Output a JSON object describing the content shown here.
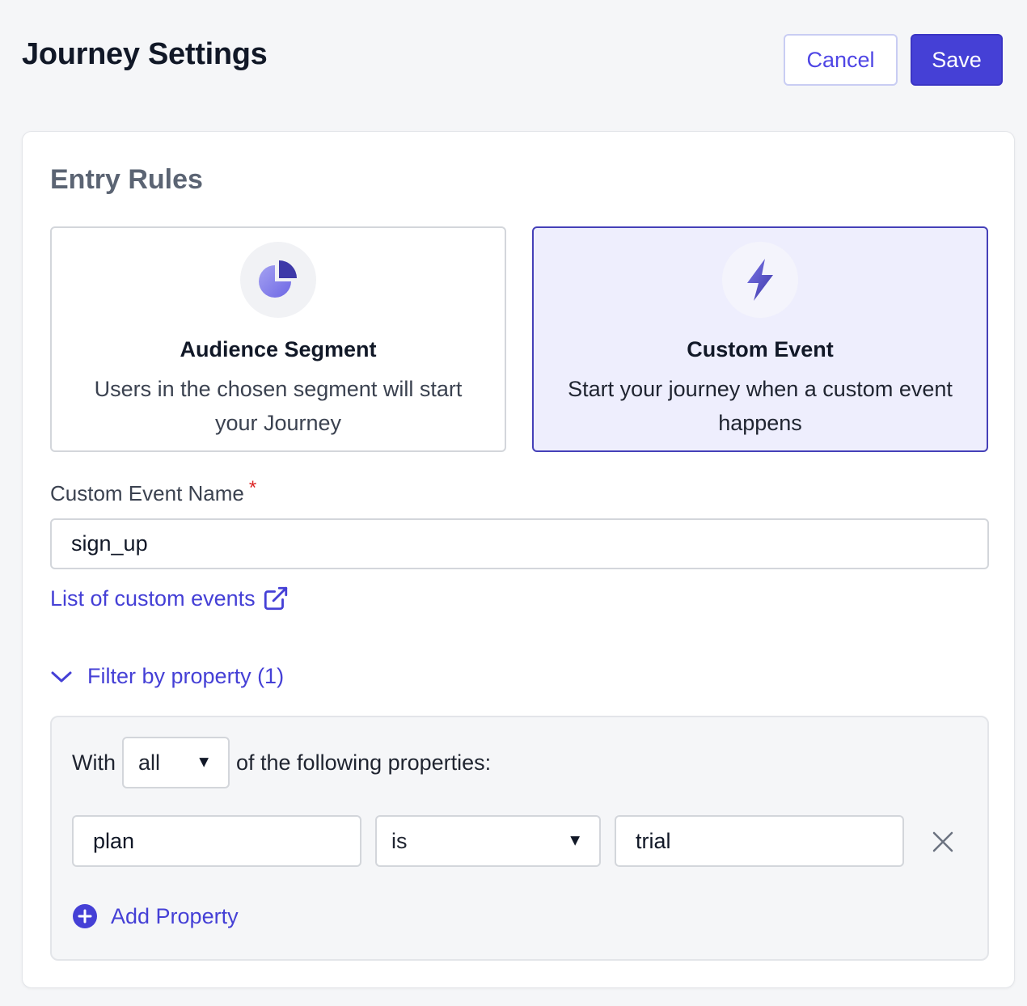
{
  "header": {
    "title": "Journey Settings",
    "cancel_label": "Cancel",
    "save_label": "Save"
  },
  "entry_rules": {
    "title": "Entry Rules",
    "options": [
      {
        "title": "Audience Segment",
        "description": "Users in the chosen segment will start your Journey",
        "icon": "pie-chart-icon",
        "selected": false
      },
      {
        "title": "Custom Event",
        "description": "Start your journey when a custom event happens",
        "icon": "lightning-bolt-icon",
        "selected": true
      }
    ],
    "event_name_label": "Custom Event Name",
    "required_mark": "*",
    "event_name_value": "sign_up",
    "list_link_label": "List of custom events",
    "filter_toggle_label": "Filter by property (1)",
    "filter": {
      "with_label": "With",
      "match_value": "all",
      "following_label": "of the following properties:",
      "properties": [
        {
          "key": "plan",
          "operator": "is",
          "value": "trial"
        }
      ],
      "add_property_label": "Add Property"
    }
  },
  "colors": {
    "accent": "#4540d6",
    "selected_bg": "#eeeefd",
    "page_bg": "#f5f6f8",
    "required": "#dc2626"
  }
}
